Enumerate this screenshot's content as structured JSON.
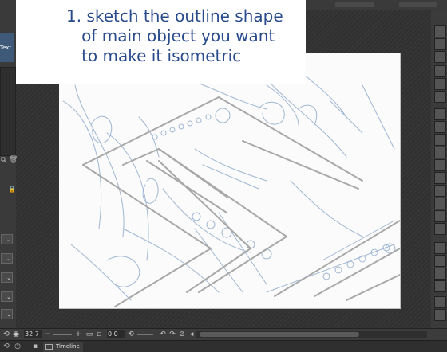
{
  "caption": {
    "text": "1. sketch the outline shape\n   of main object you want\n   to make it isometric"
  },
  "left_panel": {
    "text_button_label": "Text",
    "dropdown_glyph": "⌄"
  },
  "status_bar": {
    "zoom_value": "32.7",
    "angle_value": "0.0"
  },
  "tab_bar": {
    "timeline_label": "Timeline"
  },
  "icons": {
    "caption_color": "#294b8c",
    "sketch_color": "#9fb6d3"
  }
}
